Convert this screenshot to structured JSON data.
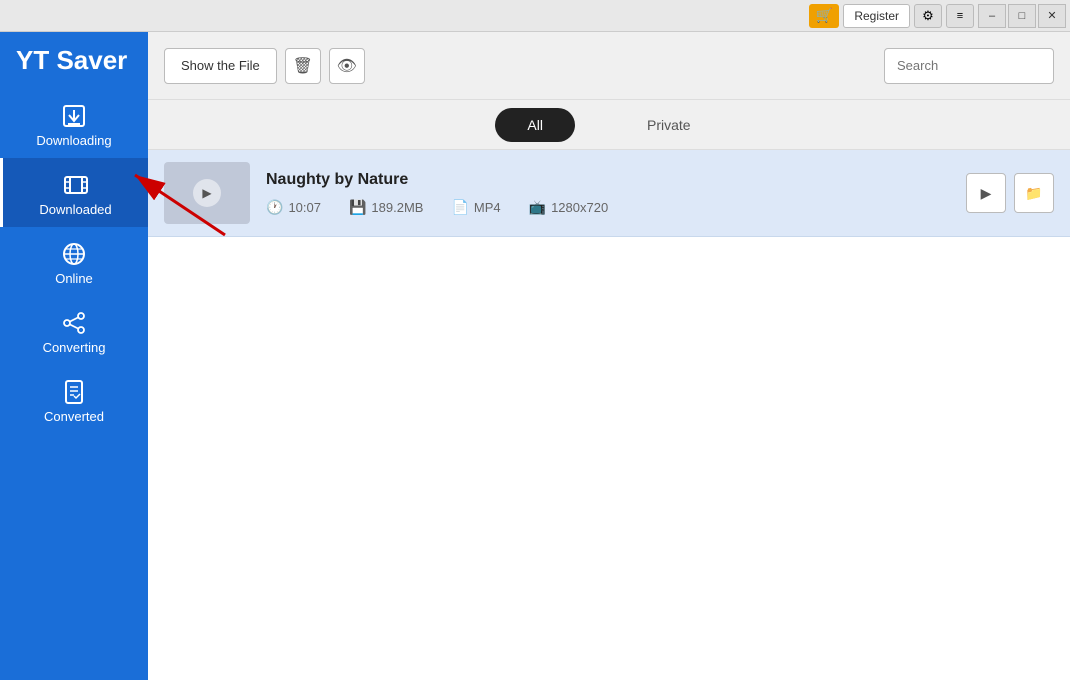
{
  "titleBar": {
    "cartIcon": "🛒",
    "registerLabel": "Register",
    "gearIcon": "⚙",
    "menuIcon": "≡",
    "minimizeIcon": "–",
    "maximizeIcon": "□",
    "closeIcon": "✕"
  },
  "sidebar": {
    "appTitle": "YT Saver",
    "navItems": [
      {
        "id": "downloading",
        "label": "Downloading",
        "icon": "download"
      },
      {
        "id": "downloaded",
        "label": "Downloaded",
        "icon": "film",
        "active": true
      },
      {
        "id": "online",
        "label": "Online",
        "icon": "globe"
      },
      {
        "id": "converting",
        "label": "Converting",
        "icon": "share"
      },
      {
        "id": "converted",
        "label": "Converted",
        "icon": "document"
      }
    ]
  },
  "toolbar": {
    "showFileLabel": "Show the File",
    "deleteIcon": "🗑",
    "eyeIcon": "👁",
    "searchPlaceholder": "Search"
  },
  "filterTabs": [
    {
      "id": "all",
      "label": "All",
      "active": true
    },
    {
      "id": "private",
      "label": "Private",
      "active": false
    }
  ],
  "videoList": [
    {
      "title": "Naughty by Nature",
      "duration": "10:07",
      "size": "189.2MB",
      "format": "MP4",
      "resolution": "1280x720"
    }
  ],
  "colors": {
    "sidebarBg": "#1a6ed8",
    "activeItem": "#1559b8",
    "videoBg": "#dde8f8",
    "activeTab": "#222222"
  }
}
